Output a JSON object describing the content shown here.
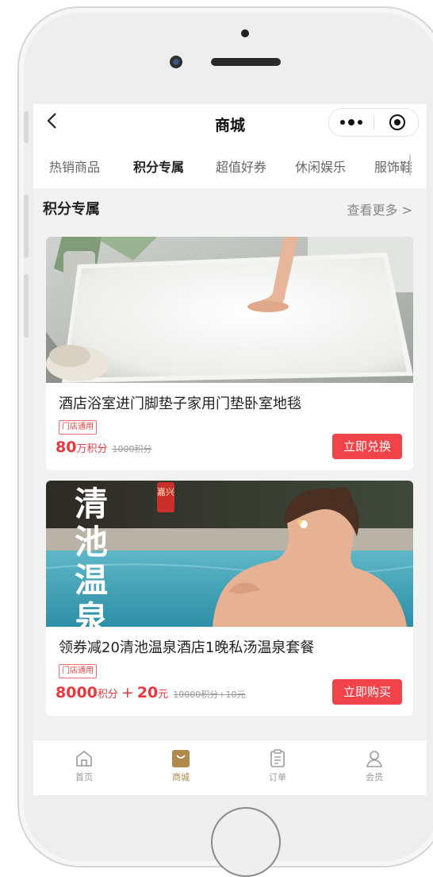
{
  "header": {
    "title": "商城",
    "back_icon": "chevron-left-icon",
    "more_icon": "more-dots-icon",
    "record_icon": "target-icon"
  },
  "tabs": [
    {
      "label": "热销商品",
      "active": false
    },
    {
      "label": "积分专属",
      "active": true
    },
    {
      "label": "超值好券",
      "active": false
    },
    {
      "label": "休闲娱乐",
      "active": false
    },
    {
      "label": "服饰鞋",
      "active": false
    }
  ],
  "section": {
    "title": "积分专属",
    "more": "查看更多 >"
  },
  "products": [
    {
      "title": "酒店浴室进门脚垫子家用门垫卧室地毯",
      "tag": "门店通用",
      "price_value": "80",
      "price_unit": "万积分",
      "original": "1000积分",
      "button": "立即兑换"
    },
    {
      "title": "领券减20清池温泉酒店1晚私汤温泉套餐",
      "tag": "门店通用",
      "price_value": "8000",
      "price_unit": "积分",
      "price_plus": "+",
      "price_cash": "20",
      "price_cash_unit": "元",
      "original": "10000积分+10元",
      "button": "立即购买",
      "image_text": [
        "清",
        "池",
        "温",
        "泉"
      ],
      "image_seal": "嘉兴"
    }
  ],
  "tabbar": [
    {
      "label": "首页",
      "icon": "home-icon",
      "active": false
    },
    {
      "label": "商城",
      "icon": "shop-bag-icon",
      "active": true
    },
    {
      "label": "订单",
      "icon": "clipboard-icon",
      "active": false
    },
    {
      "label": "会员",
      "icon": "user-icon",
      "active": false
    }
  ],
  "colors": {
    "accent": "#f0444a",
    "price": "#e8383e",
    "tabbar_active": "#b08a4a"
  }
}
